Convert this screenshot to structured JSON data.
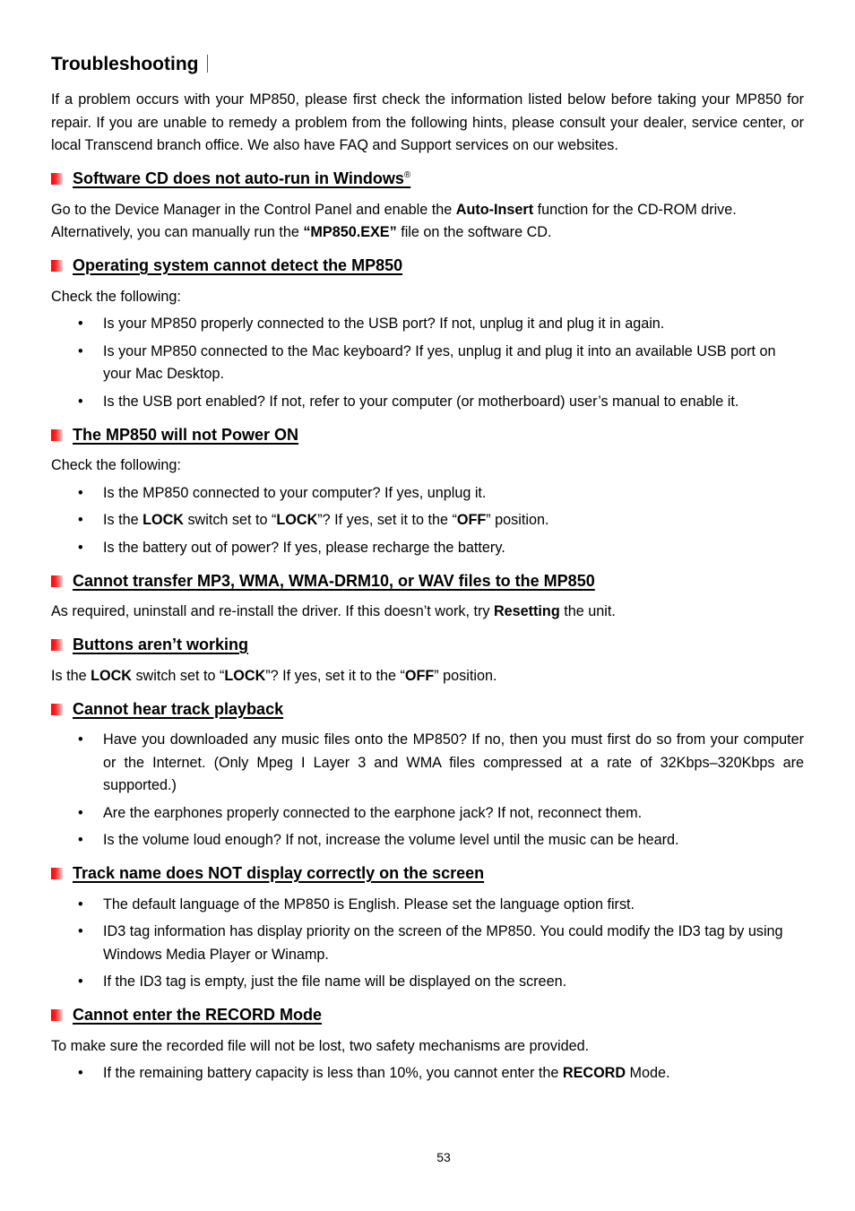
{
  "title": "Troubleshooting",
  "intro": "If a problem occurs with your MP850, please first check the information listed below before taking your MP850 for repair. If you are unable to remedy a problem from the following hints, please consult your dealer, service center, or local Transcend branch office. We also have FAQ and Support services on our websites.",
  "accent_color": "#ff0000",
  "sections": [
    {
      "heading": "Software CD does not auto-run in Windows",
      "heading_sup": "®",
      "body": {
        "p1": "Go to the Device Manager in the Control Panel and enable the ",
        "b1": "Auto-Insert",
        "p2": " function for the CD-ROM drive. Alternatively, you can manually run the ",
        "b2": "“MP850.EXE”",
        "p3": " file on the software CD."
      }
    },
    {
      "heading": "Operating system cannot detect the MP850",
      "lead": "Check the following:",
      "bullets": [
        "Is your MP850 properly connected to the USB port? If not, unplug it and plug it in again.",
        "Is your MP850 connected to the Mac keyboard? If yes, unplug it and plug it into an available USB port on your Mac Desktop.",
        "Is the USB port enabled? If not, refer to your computer (or motherboard) user’s manual to enable it."
      ]
    },
    {
      "heading": "The MP850 will not Power ON",
      "lead": "Check the following:",
      "bullets": [
        {
          "text": "Is the MP850 connected to your computer? If yes, unplug it."
        },
        {
          "t1": "Is the ",
          "b1": "LOCK",
          "t2": " switch set to “",
          "b2": "LOCK",
          "t3": "”? If yes, set it to the “",
          "b3": "OFF",
          "t4": "” position."
        },
        {
          "text": "Is the battery out of power? If yes, please recharge the battery."
        }
      ]
    },
    {
      "heading": "Cannot transfer MP3, WMA, WMA-DRM10, or WAV files to the MP850",
      "body": {
        "t1": "As required, uninstall and re-install the driver. If this doesn’t work, try ",
        "b1": "Resetting",
        "t2": " the unit."
      }
    },
    {
      "heading": "Buttons aren’t working",
      "body": {
        "t1": "Is the ",
        "b1": "LOCK",
        "t2": " switch set to “",
        "b2": "LOCK",
        "t3": "”? If yes, set it to the “",
        "b3": "OFF",
        "t4": "” position."
      }
    },
    {
      "heading": "Cannot hear track playback",
      "bullets": [
        "Have you downloaded any music files onto the MP850? If no, then you must first do so from your computer or the Internet. (Only Mpeg I Layer 3 and WMA files compressed at a rate of 32Kbps–320Kbps are supported.)",
        "Are the earphones properly connected to the earphone jack? If not, reconnect them.",
        "Is the volume loud enough? If not, increase the volume level until the music can be heard."
      ]
    },
    {
      "heading": "Track name does NOT display correctly on the screen",
      "bullets": [
        "The default language of the MP850 is English. Please set the language option first.",
        "ID3 tag information has display priority on the screen of the MP850. You could modify the ID3 tag by using Windows Media Player or Winamp.",
        "If the ID3 tag is empty, just the file name will be displayed on the screen."
      ]
    },
    {
      "heading": "Cannot enter the RECORD Mode",
      "lead": "To make sure the recorded file will not be lost, two safety mechanisms are provided.",
      "bullets": [
        {
          "t1": "If the remaining battery capacity is less than 10%, you cannot enter the ",
          "b1": "RECORD",
          "t2": " Mode."
        }
      ]
    }
  ],
  "bullet_glyph": "•",
  "page_number": "53"
}
